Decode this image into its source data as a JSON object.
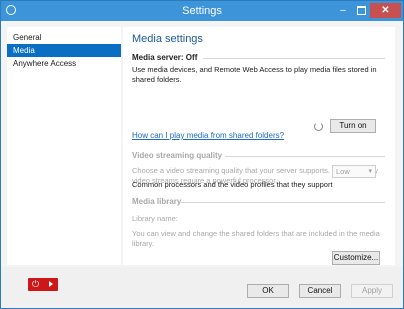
{
  "window": {
    "title": "Settings",
    "minimize_symbol": "–",
    "close_symbol": "✕"
  },
  "sidebar": {
    "items": [
      {
        "label": "General",
        "active": false
      },
      {
        "label": "Media",
        "active": true
      },
      {
        "label": "Anywhere Access",
        "active": false
      }
    ]
  },
  "main": {
    "heading": "Media settings",
    "media_server": {
      "title": "Media server: Off",
      "description": "Use media devices, and Remote Web Access to play media files stored in shared folders.",
      "turn_on_label": "Turn on",
      "help_link": "How can I play media from shared folders?"
    },
    "video_streaming": {
      "title": "Video streaming quality",
      "description": "Choose a video streaming quality that your server supports. Higher quality video streams require a powerful processor.",
      "quality_selected": "Low",
      "processors_text": "Common processors and the video profiles that they support"
    },
    "media_library": {
      "title": "Media library",
      "library_name_label": "Library name:",
      "description": "You can view and change the shared folders that are included in the media library.",
      "customize_label": "Customize..."
    }
  },
  "footer": {
    "power_symbol": "⏻",
    "ok_label": "OK",
    "cancel_label": "Cancel",
    "apply_label": "Apply"
  },
  "colors": {
    "titlebar": "#3d94d8",
    "accent": "#0a6fc2",
    "heading": "#1c5a99",
    "link": "#1e6bb8",
    "power": "#cc1818"
  }
}
